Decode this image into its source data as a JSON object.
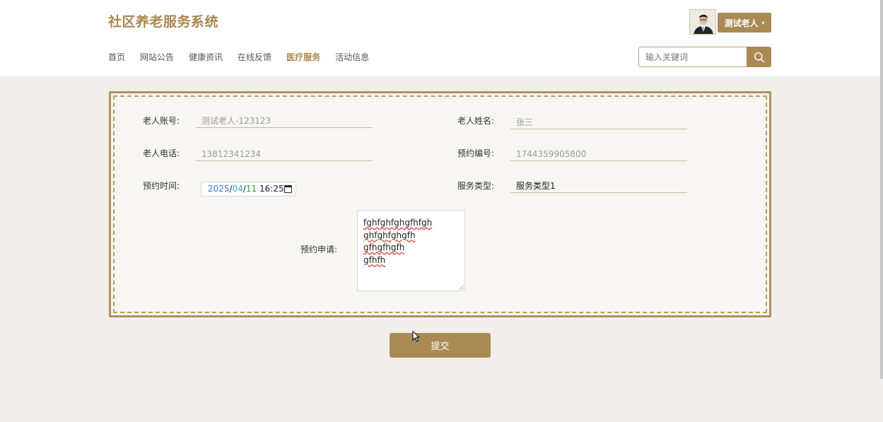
{
  "header": {
    "site_title": "社区养老服务系统",
    "nav": [
      {
        "label": "首页"
      },
      {
        "label": "网站公告"
      },
      {
        "label": "健康资讯"
      },
      {
        "label": "在线反馈"
      },
      {
        "label": "医疗服务",
        "active": true
      },
      {
        "label": "活动信息"
      }
    ],
    "user": {
      "name": "测试老人",
      "caret": "▾"
    },
    "search": {
      "placeholder": "输入关键词",
      "icon": "search-icon"
    }
  },
  "form": {
    "account": {
      "label": "老人账号:",
      "value": "测试老人-123123"
    },
    "name": {
      "label": "老人姓名:",
      "value": "张三"
    },
    "phone": {
      "label": "老人电话:",
      "value": "13812341234"
    },
    "booking_no": {
      "label": "预约编号:",
      "value": "1744359905800"
    },
    "booking_time": {
      "label": "预约时间:",
      "year": "2025",
      "month": "04",
      "day": "11",
      "time": "16:25",
      "icon": "calendar-icon"
    },
    "service_type": {
      "label": "服务类型:",
      "value": "服务类型1"
    },
    "application": {
      "label": "预约申请:",
      "lines": [
        "fghfghfghgfhfgh",
        "ghfghfghgfh",
        "gfhgfhgfh",
        "gfhfh"
      ]
    }
  },
  "submit": {
    "label": "提交"
  },
  "colors": {
    "accent": "#a98a55",
    "title": "#a9874e",
    "background": "#f1efeb"
  }
}
